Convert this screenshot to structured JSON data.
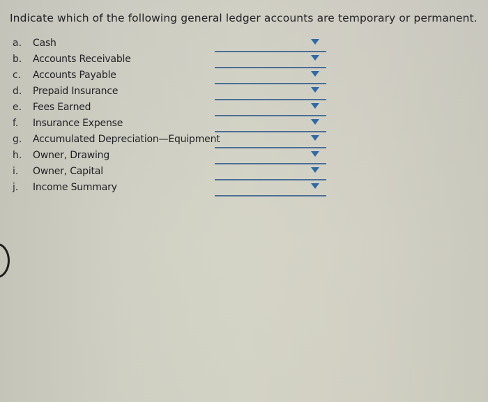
{
  "question": {
    "text": "Indicate which of the following general ledger accounts are temporary or permanent."
  },
  "accounts": [
    {
      "letter": "a.",
      "name": "Cash",
      "selected": ""
    },
    {
      "letter": "b.",
      "name": "Accounts Receivable",
      "selected": ""
    },
    {
      "letter": "c.",
      "name": "Accounts Payable",
      "selected": ""
    },
    {
      "letter": "d.",
      "name": "Prepaid Insurance",
      "selected": ""
    },
    {
      "letter": "e.",
      "name": "Fees Earned",
      "selected": ""
    },
    {
      "letter": "f.",
      "name": "Insurance Expense",
      "selected": ""
    },
    {
      "letter": "g.",
      "name": "Accumulated Depreciation—Equipment",
      "selected": ""
    },
    {
      "letter": "h.",
      "name": "Owner, Drawing",
      "selected": ""
    },
    {
      "letter": "i.",
      "name": "Owner, Capital",
      "selected": ""
    },
    {
      "letter": "j.",
      "name": "Income Summary",
      "selected": ""
    }
  ],
  "icons": {
    "dropdown_arrow": "triangle-down-icon",
    "partial_circle": "circle-outline-icon"
  },
  "colors": {
    "dropdown_line": "#4a6f95",
    "dropdown_arrow": "#2f6aa6",
    "text": "#1f1f24"
  }
}
